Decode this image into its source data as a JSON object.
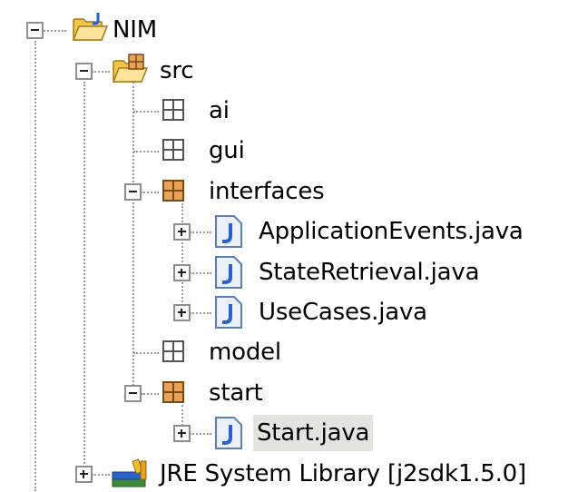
{
  "tree": {
    "root": {
      "label": "NIM",
      "expanded": true
    },
    "src": {
      "label": "src",
      "expanded": true
    },
    "packages": {
      "ai": {
        "label": "ai"
      },
      "gui": {
        "label": "gui"
      },
      "interfaces": {
        "label": "interfaces",
        "expanded": true
      },
      "model": {
        "label": "model"
      },
      "start": {
        "label": "start",
        "expanded": true
      }
    },
    "files": {
      "application_events": {
        "label": "ApplicationEvents.java"
      },
      "state_retrieval": {
        "label": "StateRetrieval.java"
      },
      "use_cases": {
        "label": "UseCases.java"
      },
      "start_java": {
        "label": "Start.java",
        "selected": true
      }
    },
    "jre": {
      "label": "JRE System Library [j2sdk1.5.0]",
      "expanded": false
    }
  },
  "icons": {
    "project": "java-project-folder-icon",
    "source_folder": "source-folder-icon",
    "empty_package": "empty-package-icon",
    "package": "package-icon",
    "java_file": "java-file-icon",
    "library": "library-icon"
  },
  "colors": {
    "selection": "#e3e3e0",
    "package_fill": "#e8a25a",
    "java_file_blue": "#2a62c9",
    "folder_yellow": "#f5c54a"
  }
}
